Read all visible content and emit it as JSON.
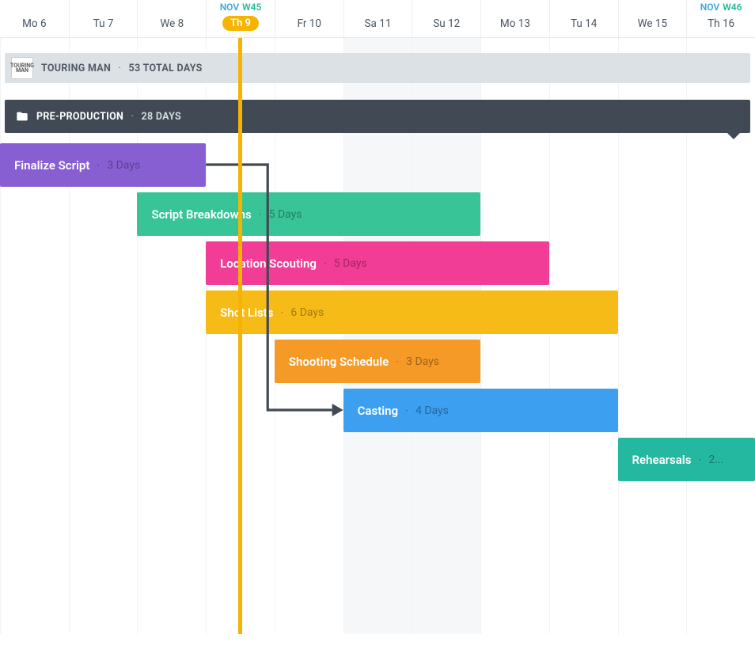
{
  "colors": {
    "purple": "#885fd2",
    "green": "#39c497",
    "pink": "#f13d95",
    "yellow": "#f6bb17",
    "orange": "#f59a26",
    "blue": "#3c9ff0",
    "teal": "#24b8a1",
    "phase": "#414a54",
    "today": "#f6b400"
  },
  "chart_data": {
    "type": "gantt",
    "unit": "days",
    "dates": [
      {
        "label": "Mo 6",
        "weekday": "Mo",
        "day": 6,
        "weekend": false
      },
      {
        "label": "Tu 7",
        "weekday": "Tu",
        "day": 7,
        "weekend": false
      },
      {
        "label": "We 8",
        "weekday": "We",
        "day": 8,
        "weekend": false
      },
      {
        "label": "Th 9",
        "weekday": "Th",
        "day": 9,
        "weekend": false,
        "today": true,
        "week_tag": {
          "month": "Nov",
          "week": "W45"
        }
      },
      {
        "label": "Fr 10",
        "weekday": "Fr",
        "day": 10,
        "weekend": false
      },
      {
        "label": "Sa 11",
        "weekday": "Sa",
        "day": 11,
        "weekend": true
      },
      {
        "label": "Su 12",
        "weekday": "Su",
        "day": 12,
        "weekend": true
      },
      {
        "label": "Mo 13",
        "weekday": "Mo",
        "day": 13,
        "weekend": false
      },
      {
        "label": "Tu 14",
        "weekday": "Tu",
        "day": 14,
        "weekend": false
      },
      {
        "label": "We 15",
        "weekday": "We",
        "day": 15,
        "weekend": false
      },
      {
        "label": "Th 16",
        "weekday": "Th",
        "day": 16,
        "weekend": false,
        "week_tag": {
          "month": "Nov",
          "week": "W46"
        }
      }
    ],
    "today_index": 3,
    "phase": {
      "name": "PRE-PRODUCTION",
      "days_text": "28 DAYS"
    },
    "tasks": [
      {
        "name": "Finalize Script",
        "days": "3 Days",
        "start": 0,
        "length": 3,
        "row": 0,
        "color": "purple"
      },
      {
        "name": "Script Breakdowns",
        "days": "5 Days",
        "start": 2,
        "length": 5,
        "row": 1,
        "color": "green"
      },
      {
        "name": "Location Scouting",
        "days": "5 Days",
        "start": 3,
        "length": 5,
        "row": 2,
        "color": "pink"
      },
      {
        "name": "Shot Lists",
        "days": "6 Days",
        "start": 3,
        "length": 6,
        "row": 3,
        "color": "yellow"
      },
      {
        "name": "Shooting Schedule",
        "days": "3 Days",
        "start": 4,
        "length": 3,
        "row": 4,
        "color": "orange"
      },
      {
        "name": "Casting",
        "days": "4 Days",
        "start": 5,
        "length": 4,
        "row": 5,
        "color": "blue"
      },
      {
        "name": "Rehearsals",
        "days": "2...",
        "start": 9,
        "length": 2,
        "row": 6,
        "color": "teal",
        "truncated": true
      }
    ],
    "dependencies": [
      {
        "from_task": 0,
        "to_task": 5
      }
    ]
  },
  "project": {
    "name": "TOURING MAN",
    "logo_text": "TOURING\nMAN",
    "dot": "·",
    "days_text": "53 TOTAL DAYS"
  },
  "phase": {
    "name": "PRE-PRODUCTION",
    "dot": "·",
    "days_text": "28 DAYS"
  }
}
